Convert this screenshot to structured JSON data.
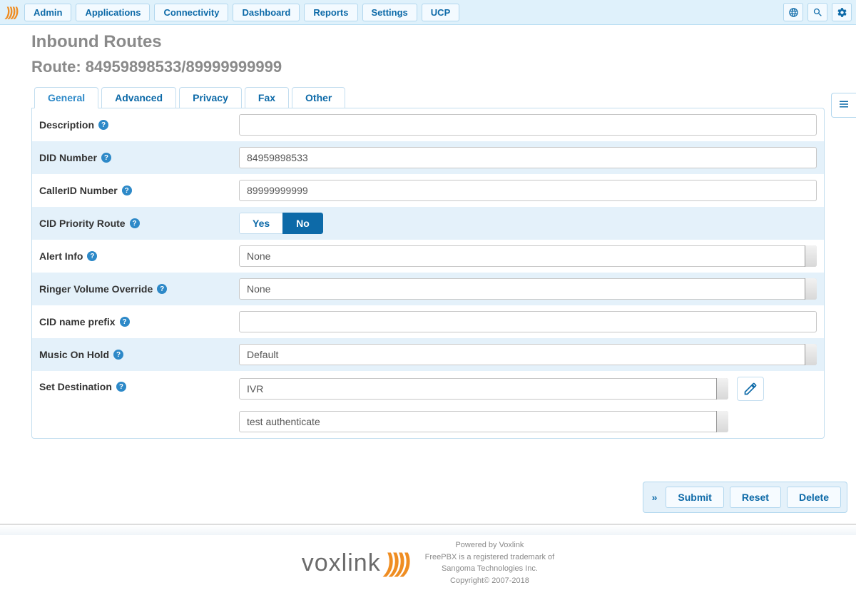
{
  "nav": {
    "items": [
      "Admin",
      "Applications",
      "Connectivity",
      "Dashboard",
      "Reports",
      "Settings",
      "UCP"
    ]
  },
  "page": {
    "title": "Inbound Routes",
    "route_title": "Route: 84959898533/89999999999"
  },
  "tabs": [
    "General",
    "Advanced",
    "Privacy",
    "Fax",
    "Other"
  ],
  "form": {
    "description": {
      "label": "Description",
      "value": ""
    },
    "did": {
      "label": "DID Number",
      "value": "84959898533"
    },
    "cid": {
      "label": "CallerID Number",
      "value": "89999999999"
    },
    "priority": {
      "label": "CID Priority Route",
      "yes": "Yes",
      "no": "No"
    },
    "alert": {
      "label": "Alert Info",
      "selected": "None"
    },
    "ringer": {
      "label": "Ringer Volume Override",
      "selected": "None"
    },
    "cidprefix": {
      "label": "CID name prefix",
      "value": ""
    },
    "moh": {
      "label": "Music On Hold",
      "selected": "Default"
    },
    "dest": {
      "label": "Set Destination",
      "type": "IVR",
      "target": "test authenticate"
    }
  },
  "actions": {
    "submit": "Submit",
    "reset": "Reset",
    "delete": "Delete"
  },
  "footer": {
    "brand": "voxlink",
    "line1": "Powered by Voxlink",
    "line2": "FreePBX is a registered trademark of",
    "line3": "Sangoma Technologies Inc.",
    "line4": "Copyright© 2007-2018"
  }
}
